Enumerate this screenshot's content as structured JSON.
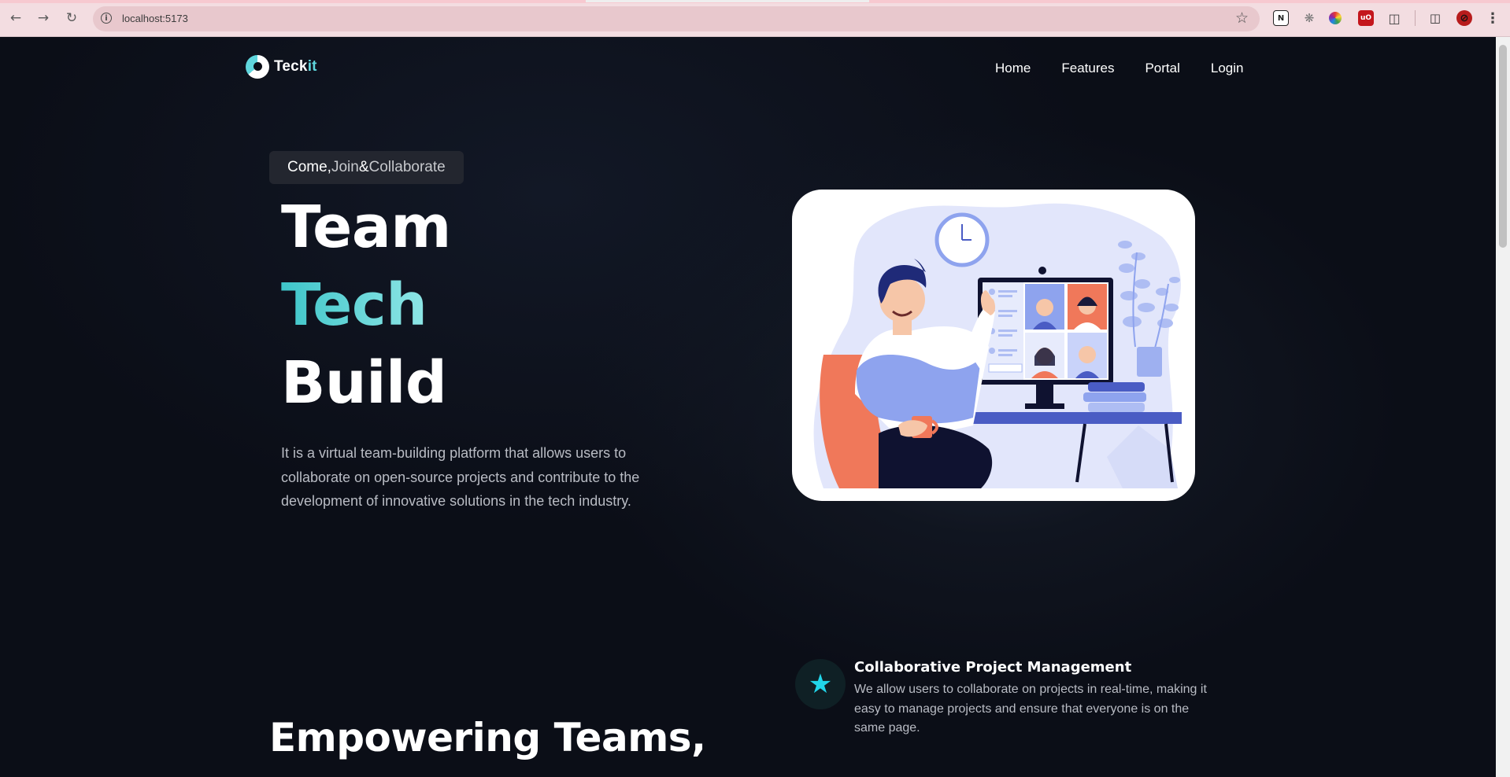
{
  "browser": {
    "url": "localhost:5173",
    "extensions": [
      "notion-icon",
      "bug-icon",
      "color-wheel-icon",
      "ublock-icon",
      "puzzle-icon"
    ]
  },
  "site": {
    "logo": {
      "name_main": "Teck",
      "name_accent": "it"
    },
    "nav": {
      "home": "Home",
      "features": "Features",
      "portal": "Portal",
      "login": "Login"
    }
  },
  "hero": {
    "tagline": {
      "come": "Come,",
      "join": "Join",
      "amp": "&",
      "collaborate": "Collaborate"
    },
    "words": {
      "first": "Team",
      "second": "Tech",
      "third": "Build"
    },
    "description": "It is a virtual team-building platform that allows users to collaborate on open-source projects and contribute to the development of innovative solutions in the tech industry."
  },
  "features": {
    "item1": {
      "icon": "star-icon",
      "title": "Collaborative Project Management",
      "description": "We allow users to collaborate on projects in real-time, making it easy to manage projects and ensure that everyone is on the same page."
    }
  },
  "section": {
    "title": "Empowering Teams,"
  },
  "colors": {
    "accent": "#5fd6dd",
    "background": "#0b0e17",
    "feature_icon": "#21d6ea"
  }
}
